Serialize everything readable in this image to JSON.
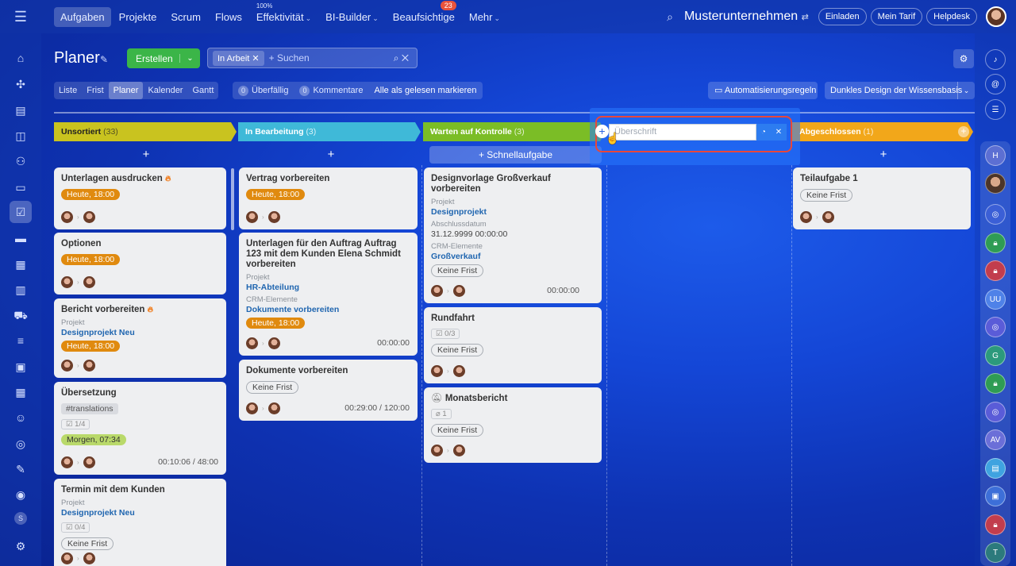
{
  "nav": {
    "items": [
      "Aufgaben",
      "Projekte",
      "Scrum",
      "Flows",
      "Effektivität",
      "BI-Builder",
      "Beaufsichtige",
      "Mehr"
    ],
    "effektivitaet_sup": "100%",
    "beaufsichtige_badge": "23",
    "company": "Musterunternehmen",
    "invite": "Einladen",
    "plan": "Mein Tarif",
    "helpdesk": "Helpdesk"
  },
  "header": {
    "title": "Planer",
    "create": "Erstellen",
    "filter_chip": "In Arbeit",
    "search_placeholder": "+ Suchen",
    "views": [
      "Liste",
      "Frist",
      "Planer",
      "Kalender",
      "Gantt"
    ],
    "overdue_count": "0",
    "overdue_label": "Überfällig",
    "comments_count": "0",
    "comments_label": "Kommentare",
    "mark_all": "Alle als gelesen markieren",
    "automation": "Automatisierungsregeln",
    "theme": "Dunkles Design der Wissensbasis"
  },
  "columns": [
    {
      "name": "Unsortiert",
      "count": "(33)",
      "color": "#c9c31f"
    },
    {
      "name": "In Bearbeitung",
      "count": "(3)",
      "color": "#3fb9d8"
    },
    {
      "name": "Warten auf Kontrolle",
      "count": "(3)",
      "color": "#7bbd26"
    },
    {
      "name": "Abgeschlossen",
      "count": "(1)",
      "color": "#f2a71a"
    }
  ],
  "quick_task": "+ Schnellaufgabe",
  "new_column": {
    "placeholder": "Überschrift"
  },
  "labels": {
    "project": "Projekt",
    "crm": "CRM-Elemente",
    "closing_date": "Abschlussdatum"
  },
  "cards": {
    "c1": {
      "title": "Unterlagen ausdrucken",
      "deadline": "Heute, 18:00"
    },
    "c2": {
      "title": "Optionen",
      "deadline": "Heute, 18:00"
    },
    "c3": {
      "title": "Bericht vorbereiten",
      "project": "Designprojekt Neu",
      "deadline": "Heute, 18:00"
    },
    "c4": {
      "title": "Übersetzung",
      "tag": "#translations",
      "checklist": "1/4",
      "deadline": "Morgen, 07:34",
      "time": "00:10:06 / 48:00"
    },
    "c5": {
      "title": "Termin mit dem Kunden",
      "project": "Designprojekt Neu",
      "checklist": "0/4",
      "deadline": "Keine Frist"
    },
    "c6": {
      "title": "Vertrag vorbereiten",
      "deadline": "Heute, 18:00"
    },
    "c7": {
      "title": "Unterlagen für den Auftrag Auftrag 123 mit dem Kunden Elena Schmidt vorbereiten",
      "project": "HR-Abteilung",
      "crm": "Dokumente vorbereiten",
      "deadline": "Heute, 18:00",
      "time": "00:00:00"
    },
    "c8": {
      "title": "Dokumente vorbereiten",
      "deadline": "Keine Frist",
      "time": "00:29:00 / 120:00"
    },
    "c9": {
      "title": "Designvorlage Großverkauf vorbereiten",
      "project": "Designprojekt",
      "closing_date": "31.12.9999 00:00:00",
      "crm": "Großverkauf",
      "deadline": "Keine Frist",
      "time": "00:00:00"
    },
    "c10": {
      "title": "Rundfahrt",
      "checklist": "0/3",
      "deadline": "Keine Frist"
    },
    "c11": {
      "title": "Monatsbericht",
      "files": "1",
      "deadline": "Keine Frist"
    },
    "c12": {
      "title": "Teilaufgabe 1",
      "deadline": "Keine Frist"
    }
  },
  "rightbar": {
    "initials": [
      "H",
      "UU",
      "G",
      "AV",
      "T"
    ]
  },
  "leftbar": {
    "last_letter": "S"
  }
}
